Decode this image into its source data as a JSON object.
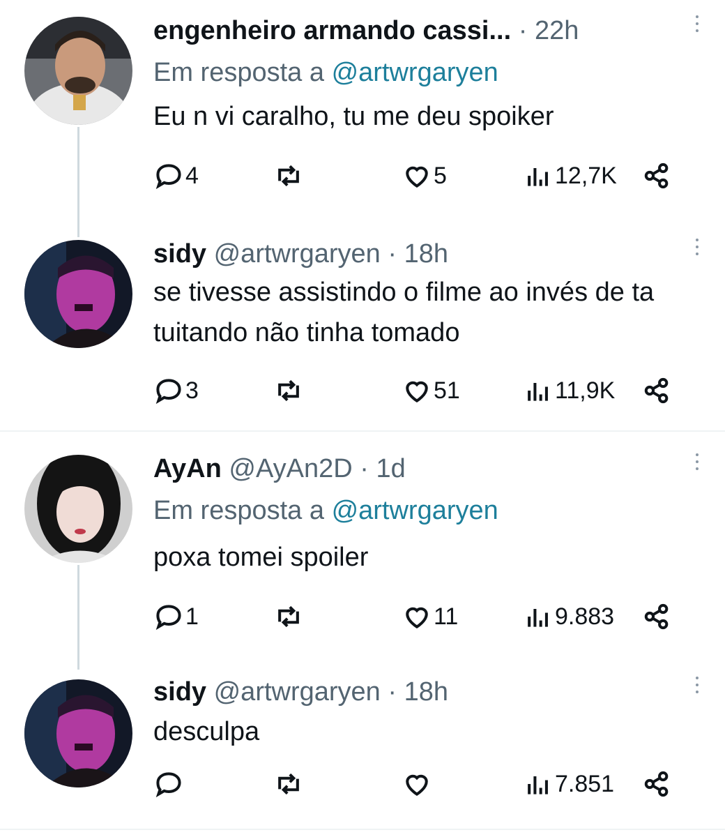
{
  "threads": [
    {
      "tweets": [
        {
          "name": "engenheiro armando cassi...",
          "handle": "",
          "time": "22h",
          "reply_label": "Em resposta a",
          "reply_to": "@artwrgaryen",
          "text": "Eu n vi caralho, tu me deu spoiker",
          "replies": "4",
          "likes": "5",
          "views": "12,7K"
        },
        {
          "name": "sidy",
          "handle": "@artwrgaryen",
          "time": "18h",
          "text": "se tivesse assistindo o filme ao invés de ta tuitando não tinha tomado",
          "replies": "3",
          "likes": "51",
          "views": "11,9K"
        }
      ]
    },
    {
      "tweets": [
        {
          "name": "AyAn",
          "handle": "@AyAn2D",
          "time": "1d",
          "reply_label": "Em resposta a",
          "reply_to": "@artwrgaryen",
          "text": "poxa tomei spoiler",
          "replies": "1",
          "likes": "11",
          "views": "9.883"
        },
        {
          "name": "sidy",
          "handle": "@artwrgaryen",
          "time": "18h",
          "text": "desculpa",
          "replies": "",
          "likes": "",
          "views": "7.851"
        }
      ]
    }
  ],
  "separator": "·",
  "icons": [
    "reply-icon",
    "retweet-icon",
    "like-icon",
    "views-icon",
    "share-icon",
    "more-icon"
  ],
  "colors": {
    "text": "#0f1419",
    "secondary": "#536471",
    "mention": "#1d7f9b",
    "divider": "#eff3f4"
  }
}
